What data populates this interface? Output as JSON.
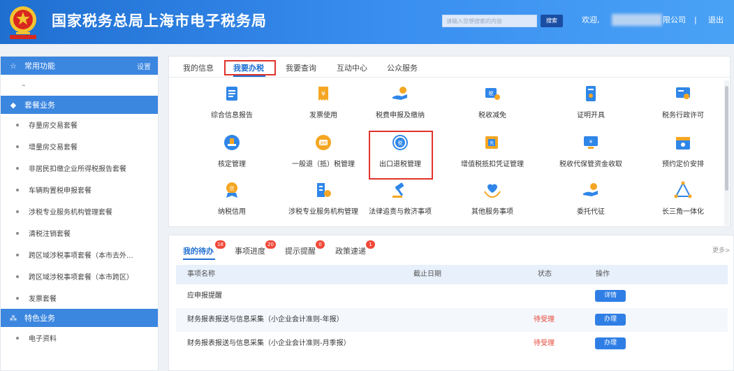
{
  "header": {
    "title": "国家税务总局上海市电子税务局",
    "search_placeholder": "请输入您想搜索的内容",
    "search_button": "搜索",
    "welcome": "欢迎,",
    "company_suffix": "限公司",
    "separator": "|",
    "logout": "退出"
  },
  "sidebar": {
    "common_title": "常用功能",
    "common_setting": "设置",
    "common_empty": "–",
    "package_title": "套餐业务",
    "package_items": [
      "存量房交易套餐",
      "增量房交易套餐",
      "非居民扣缴企业所得税报告套餐",
      "车辆购置税申报套餐",
      "涉税专业服务机构管理套餐",
      "清税注销套餐",
      "跨区域涉税事项套餐（本市去外...",
      "跨区域涉税事项套餐（本市跨区）",
      "发票套餐"
    ],
    "special_title": "特色业务",
    "special_items": [
      "电子资料"
    ]
  },
  "tabs": [
    "我的信息",
    "我要办税",
    "我要查询",
    "互动中心",
    "公众服务"
  ],
  "active_tab": "我要办税",
  "services": [
    {
      "label": "综合信息报告",
      "icon": "document-report-icon"
    },
    {
      "label": "发票使用",
      "icon": "invoice-icon"
    },
    {
      "label": "税费申报及缴纳",
      "icon": "hand-coin-icon"
    },
    {
      "label": "税收减免",
      "icon": "tax-reduction-icon"
    },
    {
      "label": "证明开具",
      "icon": "certificate-icon"
    },
    {
      "label": "税务行政许可",
      "icon": "license-icon"
    },
    {
      "label": "核定管理",
      "icon": "stamp-icon"
    },
    {
      "label": "一般退（抵）税管理",
      "icon": "refund-icon"
    },
    {
      "label": "出口退税管理",
      "icon": "export-refund-icon"
    },
    {
      "label": "增值税抵扣凭证管理",
      "icon": "voucher-icon"
    },
    {
      "label": "税收代保管资金收取",
      "icon": "money-screen-icon"
    },
    {
      "label": "预约定价安排",
      "icon": "calendar-icon"
    },
    {
      "label": "纳税信用",
      "icon": "credit-medal-icon"
    },
    {
      "label": "涉税专业服务机构管理",
      "icon": "building-gear-icon"
    },
    {
      "label": "法律追责与救济事项",
      "icon": "gavel-icon"
    },
    {
      "label": "其他服务事项",
      "icon": "heart-hands-icon"
    },
    {
      "label": "委托代征",
      "icon": "hand-coin-icon"
    },
    {
      "label": "长三角一体化",
      "icon": "triangle-network-icon"
    }
  ],
  "todo": {
    "tabs": [
      {
        "label": "我的待办",
        "badge": "18"
      },
      {
        "label": "事项进度",
        "badge": "20"
      },
      {
        "label": "提示提醒",
        "badge": "0"
      },
      {
        "label": "政策速递",
        "badge": "1"
      }
    ],
    "more": "更多>",
    "columns": [
      "事项名称",
      "截止日期",
      "状态",
      "操作"
    ],
    "rows": [
      {
        "name": "应申报提醒",
        "deadline": "",
        "status": "",
        "action": "详情"
      },
      {
        "name": "财务报表报送与信息采集（小企业会计准则-年报）",
        "deadline": "",
        "status": "待受理",
        "action": "办理"
      },
      {
        "name": "财务报表报送与信息采集（小企业会计准则-月季报）",
        "deadline": "",
        "status": "待受理",
        "action": "办理"
      }
    ]
  },
  "colors": {
    "header_blue": "#1f6fd1",
    "sidebar_head": "#3b86df",
    "highlight_red": "#e0332c",
    "badge_red": "#f04a3a"
  }
}
